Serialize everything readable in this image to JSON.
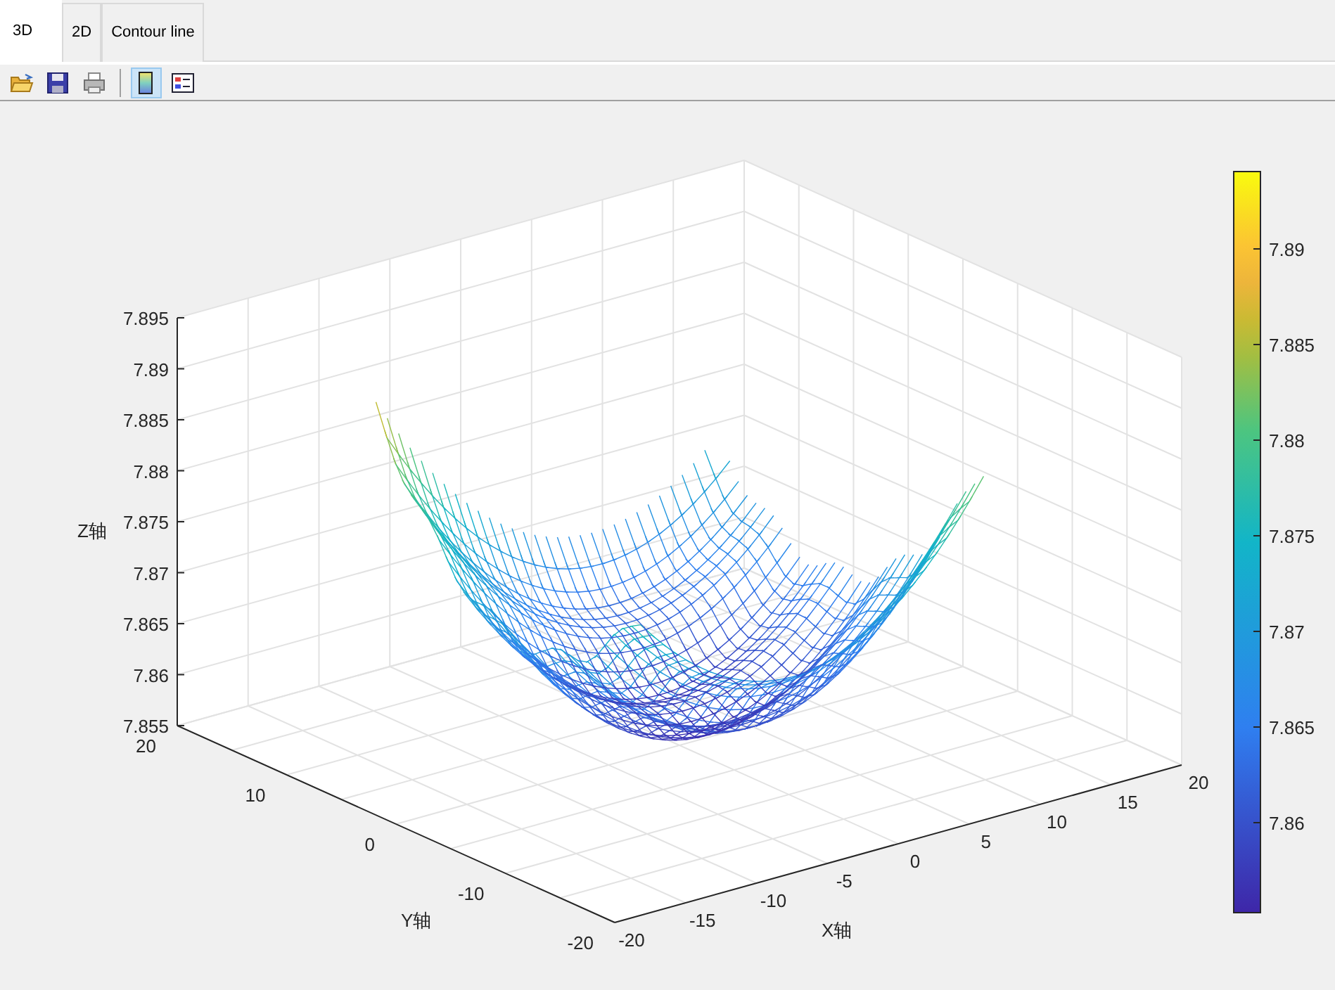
{
  "tabs": [
    {
      "label": "3D",
      "selected": true
    },
    {
      "label": "2D",
      "selected": false
    },
    {
      "label": "Contour line",
      "selected": false
    }
  ],
  "toolbar": [
    {
      "kind": "open",
      "selected": false
    },
    {
      "kind": "save",
      "selected": false
    },
    {
      "kind": "print",
      "selected": false
    },
    {
      "kind": "separator"
    },
    {
      "kind": "colorbar",
      "selected": true
    },
    {
      "kind": "legend",
      "selected": false
    }
  ],
  "axes": {
    "zlabel": "Z轴",
    "ylabel": "Y轴",
    "xlabel": "X轴",
    "z_ticks": [
      "7.895",
      "7.89",
      "7.885",
      "7.88",
      "7.875",
      "7.87",
      "7.865",
      "7.86",
      "7.855"
    ],
    "y_ticks": [
      "20",
      "10",
      "0",
      "-10",
      "-20"
    ],
    "x_ticks": [
      "-20",
      "-15",
      "-10",
      "-5",
      "0",
      "5",
      "10",
      "15",
      "20"
    ]
  },
  "colorbar": {
    "ticks": [
      "7.89",
      "7.885",
      "7.88",
      "7.875",
      "7.87",
      "7.865",
      "7.86"
    ]
  }
}
